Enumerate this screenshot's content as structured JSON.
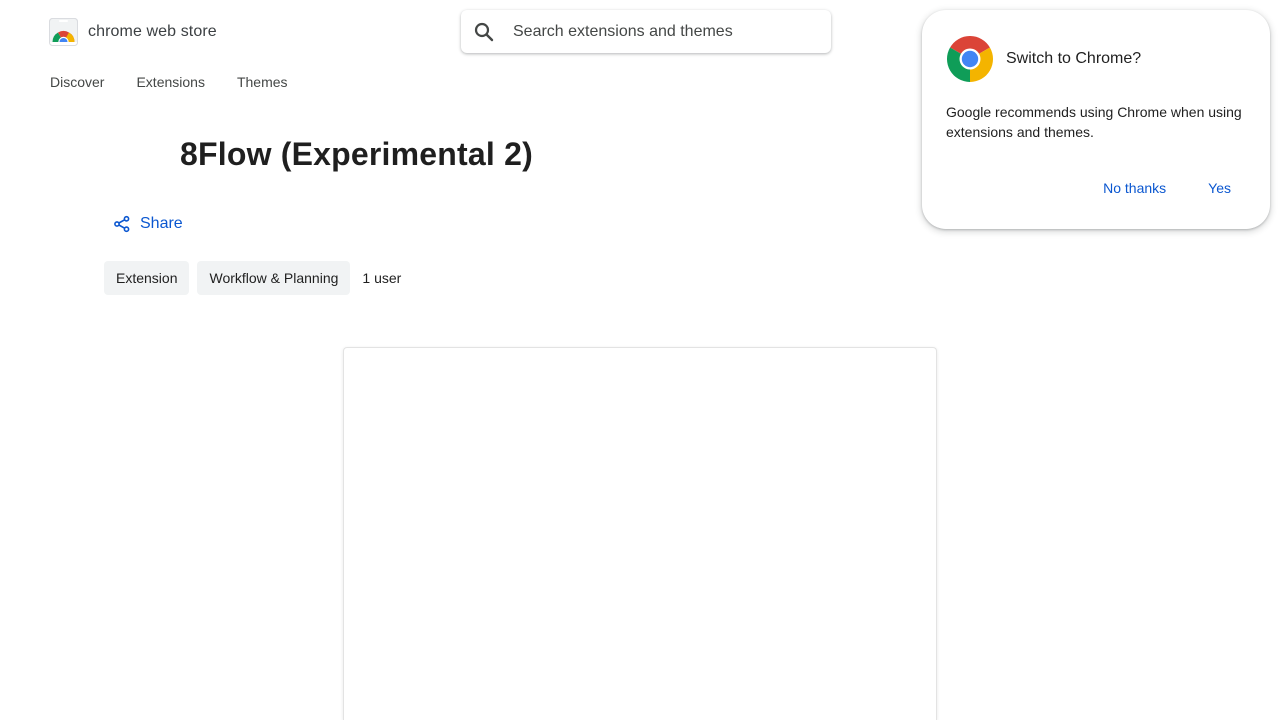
{
  "header": {
    "brand_name": "chrome web store",
    "search": {
      "placeholder": "Search extensions and themes"
    },
    "nav": [
      {
        "label": "Discover"
      },
      {
        "label": "Extensions"
      },
      {
        "label": "Themes"
      }
    ]
  },
  "detail": {
    "title": "8Flow (Experimental 2)",
    "share_label": "Share",
    "chips": [
      {
        "label": "Extension"
      },
      {
        "label": "Workflow & Planning"
      }
    ],
    "user_count": "1 user"
  },
  "dialog": {
    "title": "Switch to Chrome?",
    "body": "Google recommends using Chrome when using extensions and themes.",
    "no_label": "No thanks",
    "yes_label": "Yes"
  },
  "colors": {
    "link_blue": "#0b57d0",
    "chip_bg": "#f1f3f4",
    "chrome_red": "#db4437",
    "chrome_yellow": "#f4b400",
    "chrome_green": "#0f9d58",
    "chrome_blue": "#4285f4"
  }
}
